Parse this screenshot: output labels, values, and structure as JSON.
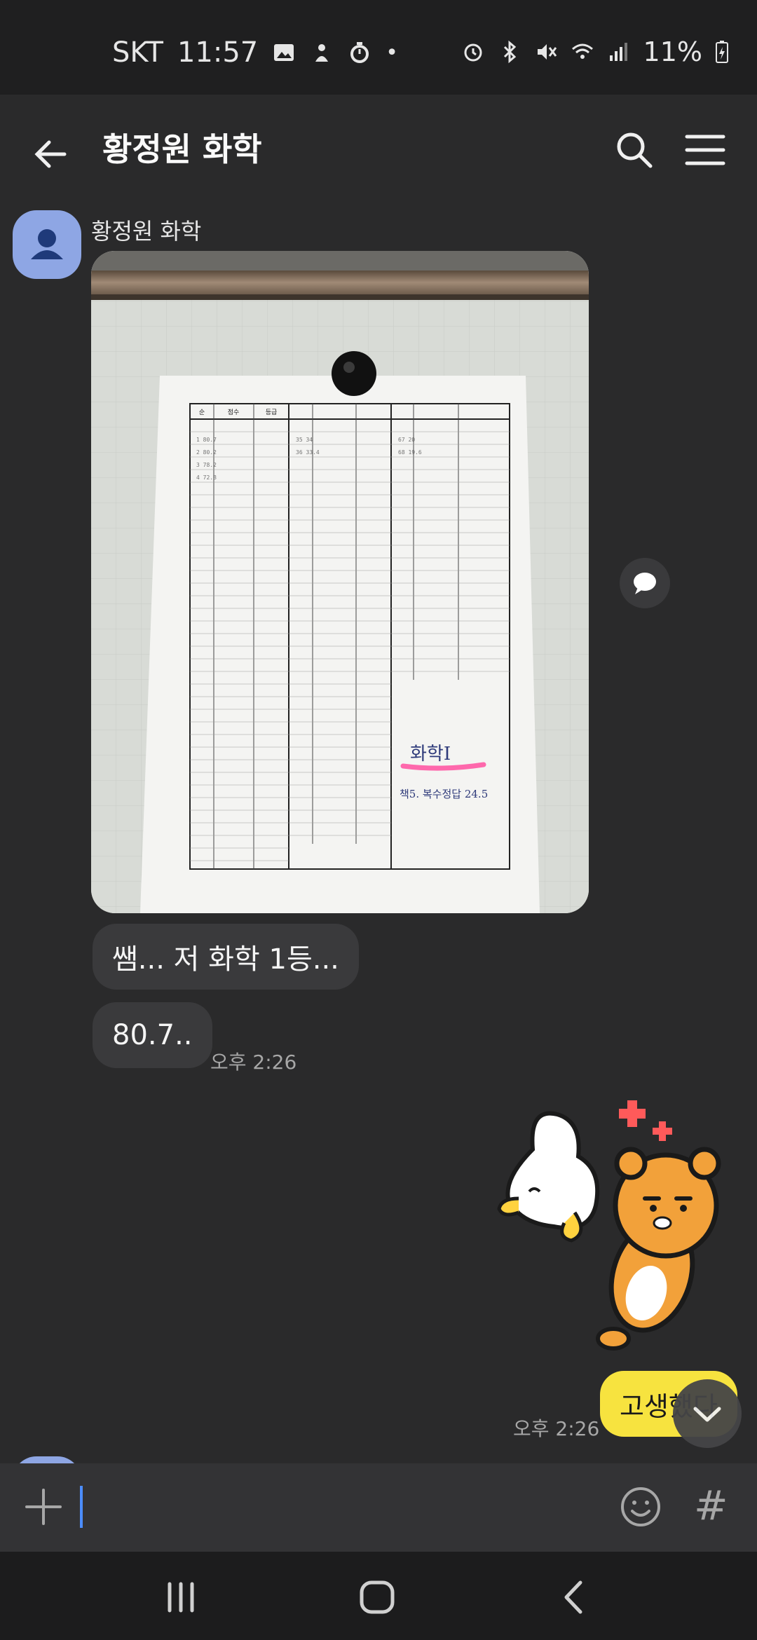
{
  "status_bar": {
    "carrier": "SKT",
    "time": "11:57",
    "battery": "11%"
  },
  "header": {
    "title": "황정원 화학"
  },
  "chat": {
    "sender_name": "황정원 화학",
    "messages": [
      {
        "text": "쌤... 저 화학 1등..."
      },
      {
        "text": "80.7..",
        "time": "오후 2:26"
      }
    ],
    "my_message": {
      "text": "고생했다",
      "time": "오후 2:26"
    }
  },
  "photo": {
    "table_headers": [
      "순",
      "점수",
      "등급"
    ],
    "handwriting": [
      "화학Ⅰ",
      "책5. 복수정답 24.5"
    ]
  },
  "input": {
    "placeholder": ""
  },
  "icons": {
    "back": "back-arrow-icon",
    "search": "search-icon",
    "menu": "hamburger-menu-icon",
    "plus": "plus-icon",
    "emoji": "emoji-icon",
    "hash": "#"
  },
  "colors": {
    "my_bubble": "#f7e33f",
    "avatar": "#8ea6e4",
    "caret": "#4c8dff"
  }
}
